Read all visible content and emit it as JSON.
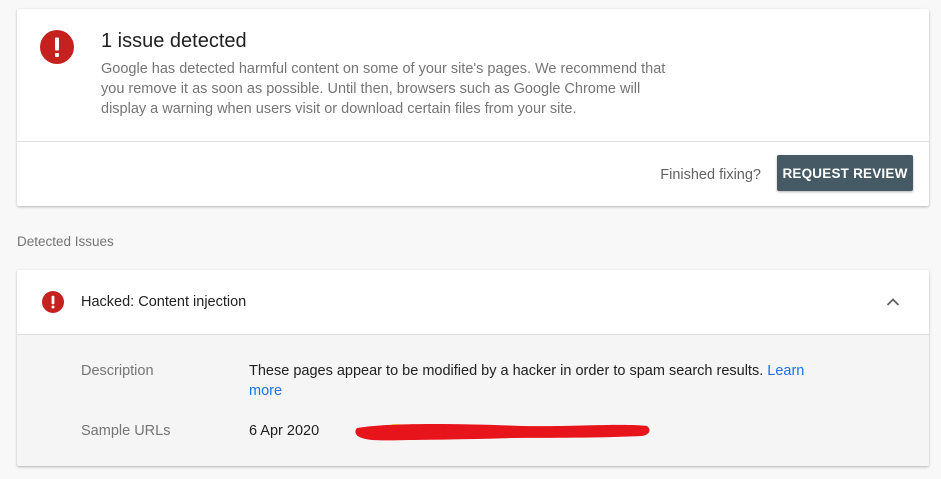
{
  "summary": {
    "title": "1 issue detected",
    "description": "Google has detected harmful content on some of your site's pages. We recommend that you remove it as soon as possible. Until then, browsers such as Google Chrome will display a warning when users visit or download certain files from your site.",
    "finished_label": "Finished fixing?",
    "review_button_label": "REQUEST REVIEW",
    "icon": "alert-circle-icon"
  },
  "section_label": "Detected Issues",
  "issue": {
    "title": "Hacked: Content injection",
    "icon": "alert-circle-icon",
    "expand_icon": "chevron-up-icon",
    "description_label": "Description",
    "description_text": "These pages appear to be modified by a hacker in order to spam search results.",
    "learn_more_label": "Learn more",
    "sample_urls_label": "Sample URLs",
    "sample_url_date": "6 Apr 2020"
  },
  "colors": {
    "alert_red": "#c5221f",
    "button_bg": "#455a64",
    "link_blue": "#1a73e8",
    "redaction_red": "#e8141c",
    "highlight_yellow": "#eef03a"
  }
}
